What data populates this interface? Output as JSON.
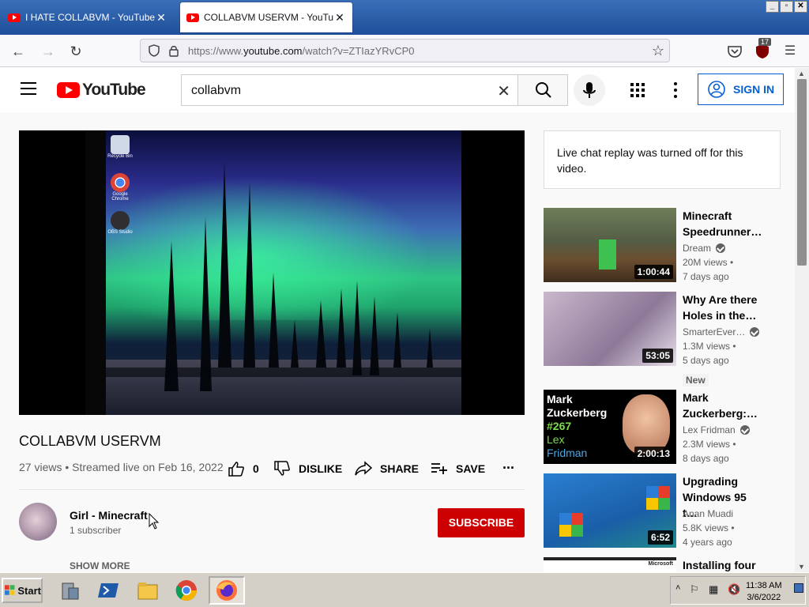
{
  "browser": {
    "tabs": [
      {
        "title": "I HATE COLLABVM - YouTube",
        "active": false
      },
      {
        "title": "COLLABVM USERVM - YouTube",
        "active": true
      }
    ],
    "close_glyph": "✕",
    "url_prefix": "https://www.",
    "url_domain": "youtube.com",
    "url_path": "/watch?v=ZTIazYRvCP0",
    "ublock_count": "17",
    "window_buttons": [
      "_",
      "▫",
      "✕"
    ]
  },
  "youtube": {
    "logo_text": "YouTube",
    "search_query": "collabvm",
    "sign_in_label": "SIGN IN",
    "video": {
      "title": "COLLABVM USERVM",
      "stats": "27 views • Streamed live on Feb 16, 2022",
      "like_count": "0",
      "dislike_label": "DISLIKE",
      "share_label": "SHARE",
      "save_label": "SAVE",
      "more_label": "..."
    },
    "channel": {
      "name": "Girl - Minecraft",
      "subscribers": "1 subscriber",
      "subscribe_label": "SUBSCRIBE",
      "show_more_label": "SHOW MORE"
    },
    "vm_desktop_icons": [
      {
        "label": "Recycle Bin",
        "icon": "recycle-bin-icon"
      },
      {
        "label": "Google Chrome",
        "icon": "chrome-icon"
      },
      {
        "label": "OBS Studio",
        "icon": "obs-icon"
      }
    ],
    "live_chat_notice": "Live chat replay was turned off for this video.",
    "recommendations": [
      {
        "title": "Minecraft Speedrunner…",
        "channel": "Dream",
        "verified": true,
        "views": "20M views •",
        "age": "7 days ago",
        "duration": "1:00:44",
        "badge": ""
      },
      {
        "title": "Why Are there Holes in the…",
        "channel": "SmarterEver…",
        "verified": true,
        "views": "1.3M views •",
        "age": "5 days ago",
        "duration": "53:05",
        "badge": "New"
      },
      {
        "title": "Mark Zuckerberg:…",
        "channel": "Lex Fridman",
        "verified": true,
        "views": "2.3M views •",
        "age": "8 days ago",
        "duration": "2:00:13",
        "badge": "",
        "thumb_text": [
          "Mark",
          "Zuckerberg",
          "#267",
          "Lex",
          "Fridman"
        ]
      },
      {
        "title": "Upgrading Windows 95 t…",
        "channel": "Anan Muadi",
        "verified": false,
        "views": "5.8K views •",
        "age": "4 years ago",
        "duration": "6:52",
        "badge": ""
      },
      {
        "title": "Installing four",
        "channel": "",
        "verified": false,
        "views": "",
        "age": "",
        "duration": "",
        "badge": "",
        "thumb_text": [
          "Microsoft"
        ]
      }
    ]
  },
  "taskbar": {
    "start_label": "Start",
    "time": "11:38 AM",
    "date": "3/6/2022",
    "apps": [
      "server-manager-icon",
      "powershell-icon",
      "file-explorer-icon",
      "chrome-icon",
      "firefox-icon"
    ]
  },
  "colors": {
    "youtube_red": "#ff0000",
    "subscribe_red": "#cc0000",
    "link_blue": "#065fd4",
    "win_taskbar": "#d4d0c8"
  }
}
